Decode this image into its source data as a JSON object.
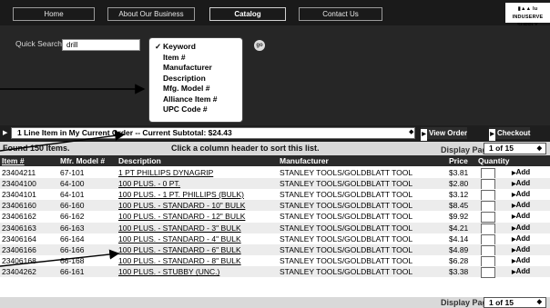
{
  "nav": {
    "items": [
      "Home",
      "About Our Business",
      "Catalog",
      "Contact Us"
    ],
    "logo_line1": "▮▲▲ lu",
    "logo_line2": "INDUSERVE SUPPLY"
  },
  "search": {
    "label": "Quick Search:",
    "value": "drill",
    "go_label": "go",
    "options": [
      {
        "label": "Keyword",
        "checked": true
      },
      {
        "label": "Item #",
        "checked": false
      },
      {
        "label": "Manufacturer",
        "checked": false
      },
      {
        "label": "Description",
        "checked": false
      },
      {
        "label": "Mfg. Model #",
        "checked": false
      },
      {
        "label": "Alliance Item #",
        "checked": false
      },
      {
        "label": "UPC Code #",
        "checked": false
      }
    ]
  },
  "order": {
    "summary": "1 Line Item in My Current Order -- Current Subtotal: $24.43",
    "view_order": "View Order",
    "checkout": "Checkout"
  },
  "results": {
    "found": "Found 150 Items.",
    "hint": "Click a column header to sort this list.",
    "display_page_label": "Display Page:",
    "display_page_value": "1 of 15",
    "columns": [
      "Item #",
      "Mfr. Model #",
      "Description",
      "Manufacturer",
      "Price",
      "Quantity"
    ],
    "add_label": "Add",
    "rows": [
      {
        "item": "23404211",
        "model": "67-101",
        "desc": "1 PT PHILLIPS DYNAGRIP",
        "mfr": "STANLEY TOOLS/GOLDBLATT TOOL",
        "price": "$3.81"
      },
      {
        "item": "23404100",
        "model": "64-100",
        "desc": "100 PLUS. - 0 PT.",
        "mfr": "STANLEY TOOLS/GOLDBLATT TOOL",
        "price": "$2.80"
      },
      {
        "item": "23404101",
        "model": "64-101",
        "desc": "100 PLUS. - 1 PT. PHILLIPS (BULK)",
        "mfr": "STANLEY TOOLS/GOLDBLATT TOOL",
        "price": "$3.12"
      },
      {
        "item": "23406160",
        "model": "66-160",
        "desc": "100 PLUS. - STANDARD - 10\" BULK",
        "mfr": "STANLEY TOOLS/GOLDBLATT TOOL",
        "price": "$8.45"
      },
      {
        "item": "23406162",
        "model": "66-162",
        "desc": "100 PLUS. - STANDARD - 12\" BULK",
        "mfr": "STANLEY TOOLS/GOLDBLATT TOOL",
        "price": "$9.92"
      },
      {
        "item": "23406163",
        "model": "66-163",
        "desc": "100 PLUS. - STANDARD - 3\" BULK",
        "mfr": "STANLEY TOOLS/GOLDBLATT TOOL",
        "price": "$4.21"
      },
      {
        "item": "23406164",
        "model": "66-164",
        "desc": "100 PLUS. - STANDARD - 4\" BULK",
        "mfr": "STANLEY TOOLS/GOLDBLATT TOOL",
        "price": "$4.14"
      },
      {
        "item": "23406166",
        "model": "66-166",
        "desc": "100 PLUS. - STANDARD - 6\" BULK",
        "mfr": "STANLEY TOOLS/GOLDBLATT TOOL",
        "price": "$4.89"
      },
      {
        "item": "23406168",
        "model": "66-168",
        "desc": "100 PLUS. - STANDARD - 8\" BULK",
        "mfr": "STANLEY TOOLS/GOLDBLATT TOOL",
        "price": "$6.28"
      },
      {
        "item": "23404262",
        "model": "66-161",
        "desc": "100 PLUS. - STUBBY (UNC.)",
        "mfr": "STANLEY TOOLS/GOLDBLATT TOOL",
        "price": "$3.38"
      }
    ]
  }
}
